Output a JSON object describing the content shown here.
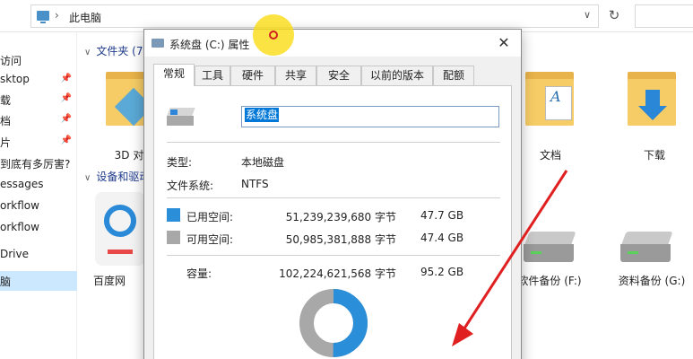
{
  "explorer": {
    "address": "此电脑",
    "folders_header": "文件夹 (7)",
    "devices_header": "设备和驱动",
    "nav_items": [
      {
        "label": "访问",
        "pinned": false
      },
      {
        "label": "sktop",
        "pinned": true
      },
      {
        "label": "载",
        "pinned": true
      },
      {
        "label": "档",
        "pinned": true
      },
      {
        "label": "片",
        "pinned": true
      },
      {
        "label": "到底有多厉害?",
        "pinned": false
      },
      {
        "label": "essages",
        "pinned": false
      },
      {
        "label": "orkflow",
        "pinned": false
      },
      {
        "label": "orkflow",
        "pinned": false
      },
      {
        "label": "Drive",
        "pinned": false
      },
      {
        "label": "脑",
        "pinned": false
      }
    ],
    "folders": {
      "threed": "3D 对",
      "documents": "文档",
      "downloads": "下载"
    },
    "app_label": "百度网",
    "drives": {
      "f": "软件备份 (F:)",
      "g": "资料备份 (G:)"
    }
  },
  "dialog": {
    "title": "系统盘 (C:) 属性",
    "tabs": [
      "常规",
      "工具",
      "硬件",
      "共享",
      "安全",
      "以前的版本",
      "配额"
    ],
    "active_tab": 0,
    "volume_name": "系统盘",
    "type_label": "类型:",
    "type_value": "本地磁盘",
    "fs_label": "文件系统:",
    "fs_value": "NTFS",
    "used_label": "已用空间:",
    "used_bytes": "51,239,239,680 字节",
    "used_gb": "47.7 GB",
    "free_label": "可用空间:",
    "free_bytes": "50,985,381,888 字节",
    "free_gb": "47.4 GB",
    "capacity_label": "容量:",
    "capacity_bytes": "102,224,621,568 字节",
    "capacity_gb": "95.2 GB",
    "used_fraction": 0.501,
    "used_color": "#2a8fd8",
    "free_color": "#a8a8a8"
  }
}
